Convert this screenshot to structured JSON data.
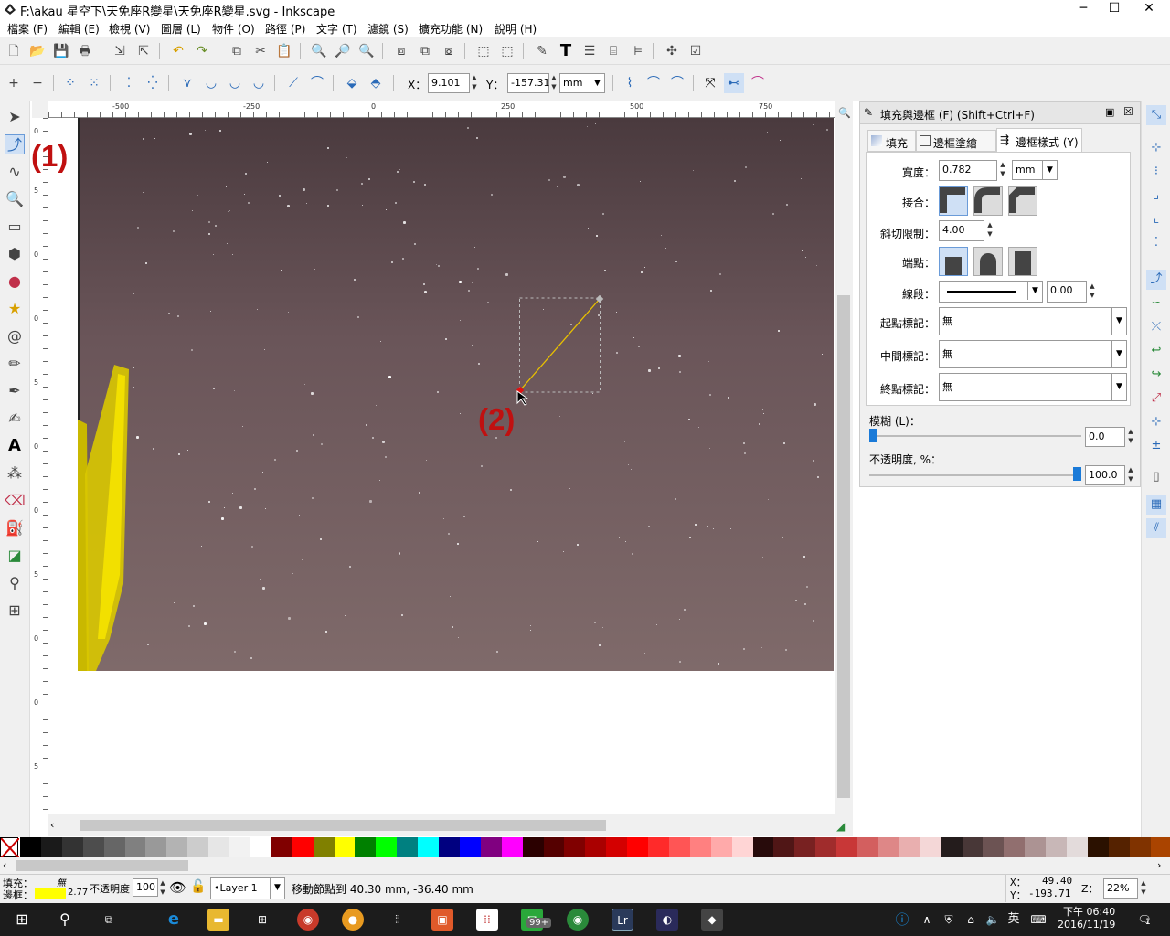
{
  "window": {
    "title": "F:\\akau 星空下\\天免座R變星\\天免座R變星.svg - Inkscape",
    "minimize": "─",
    "maximize": "☐",
    "close": "✕"
  },
  "menu": [
    "檔案 (F)",
    "編輯 (E)",
    "檢視 (V)",
    "圖層 (L)",
    "物件 (O)",
    "路徑 (P)",
    "文字 (T)",
    "濾鏡 (S)",
    "擴充功能 (N)",
    "說明 (H)"
  ],
  "node_toolbar": {
    "x_label": "X：",
    "x_value": "9.101",
    "y_label": "Y：",
    "y_value": "-157.31",
    "unit": "mm"
  },
  "rulers": {
    "h": [
      "-500",
      "-250",
      "0",
      "250",
      "500",
      "750"
    ],
    "v": [
      "0",
      "5",
      "0",
      "0",
      "5",
      "0",
      "0",
      "5",
      "0",
      "0",
      "5",
      "0",
      "0"
    ]
  },
  "annotations": {
    "one": "(1)",
    "two": "(2)"
  },
  "panel": {
    "title": "填充與邊框 (F) (Shift+Ctrl+F)",
    "tabs": [
      "填充",
      "邊框塗繪 (P)",
      "邊框樣式 (Y)"
    ],
    "width_label": "寬度：",
    "width_value": "0.782",
    "width_unit": "mm",
    "join_label": "接合：",
    "miter_label": "斜切限制：",
    "miter_value": "4.00",
    "cap_label": "端點：",
    "dash_label": "線段：",
    "dash_offset": "0.00",
    "start_marker_label": "起點標記：",
    "start_marker": "無",
    "mid_marker_label": "中間標記：",
    "mid_marker": "無",
    "end_marker_label": "終點標記：",
    "end_marker": "無",
    "blur_label": "模糊 (L)：",
    "blur_value": "0.0",
    "opacity_label": "不透明度, %：",
    "opacity_value": "100.0",
    "opacity_level": 100,
    "blur_level": 0
  },
  "palette_colors": [
    "#000000",
    "#1a1a1a",
    "#333333",
    "#4d4d4d",
    "#666666",
    "#808080",
    "#999999",
    "#b3b3b3",
    "#cccccc",
    "#e6e6e6",
    "#f2f2f2",
    "#ffffff",
    "#800000",
    "#ff0000",
    "#808000",
    "#ffff00",
    "#008000",
    "#00ff00",
    "#008080",
    "#00ffff",
    "#000080",
    "#0000ff",
    "#800080",
    "#ff00ff",
    "#2b0000",
    "#550000",
    "#800000",
    "#aa0000",
    "#d40000",
    "#ff0000",
    "#ff2a2a",
    "#ff5555",
    "#ff8080",
    "#ffaaaa",
    "#ffd5d5",
    "#280b0b",
    "#501616",
    "#782121",
    "#a02c2c",
    "#c83737",
    "#d35f5f",
    "#de8787",
    "#e9afaf",
    "#f4d7d7",
    "#241c1c",
    "#483737",
    "#6c5353",
    "#916f6f",
    "#ac9393",
    "#c8b7b7",
    "#e3dbdb",
    "#2b1100",
    "#552200",
    "#803300",
    "#aa4400",
    "#d45500"
  ],
  "status": {
    "fill_label": "填充：",
    "stroke_label": "邊框：",
    "fill_none": "無",
    "stroke_color": "#ffff00",
    "stroke_width": "2.77",
    "opacity_label": "不透明度",
    "opacity_value": "100",
    "layer": "•Layer 1",
    "message": "移動節點到 40.30 mm, -36.40 mm",
    "x_label": "X：",
    "x_value": "49.40",
    "y_label": "Y：",
    "y_value": "-193.71",
    "z_label": "Z：",
    "zoom": "22%"
  },
  "taskbar": {
    "time": "下午 06:40",
    "date": "2016/11/19",
    "ime": "英",
    "badge": "99+",
    "notif": "1"
  }
}
